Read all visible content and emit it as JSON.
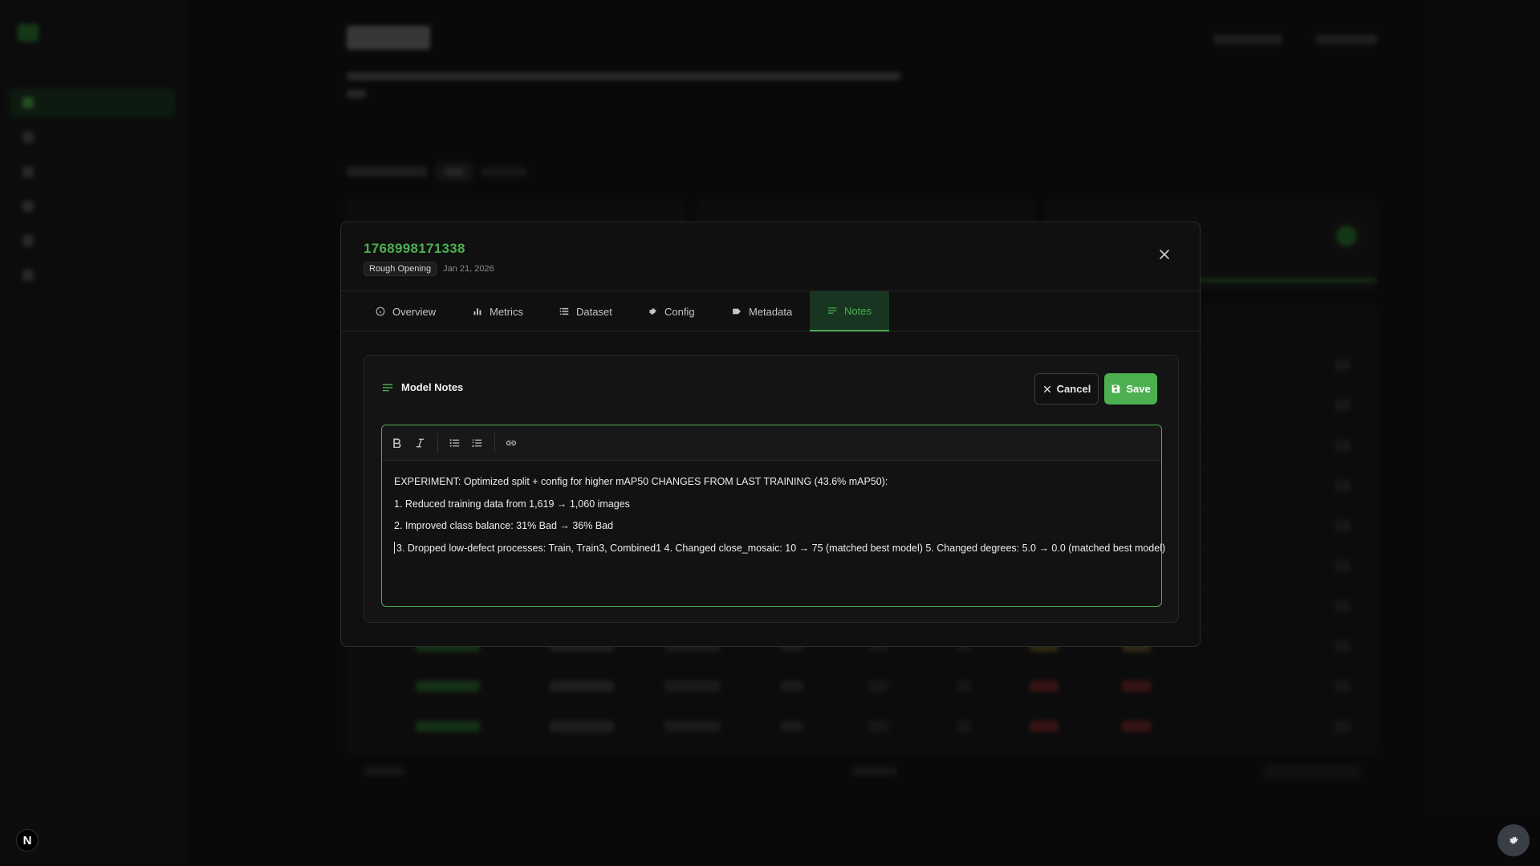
{
  "background": {
    "nav_item_count": 6,
    "row_count": 10
  },
  "modal": {
    "model_id": "1768998171338",
    "category": "Rough Opening",
    "date": "Jan 21, 2026",
    "tabs": [
      {
        "label": "Overview",
        "icon": "info-icon"
      },
      {
        "label": "Metrics",
        "icon": "bar-chart-icon"
      },
      {
        "label": "Dataset",
        "icon": "list-icon"
      },
      {
        "label": "Config",
        "icon": "gear-icon"
      },
      {
        "label": "Metadata",
        "icon": "tag-icon"
      },
      {
        "label": "Notes",
        "icon": "notes-icon",
        "active": true
      }
    ],
    "notes": {
      "title": "Model Notes",
      "cancel_label": "Cancel",
      "save_label": "Save",
      "lines": [
        "EXPERIMENT: Optimized split + config for higher mAP50 CHANGES FROM LAST TRAINING (43.6% mAP50):",
        "1. Reduced training data from 1,619 → 1,060 images",
        "2. Improved class balance: 31% Bad → 36% Bad",
        "3. Dropped low-defect processes: Train, Train3, Combined1 4. Changed close_mosaic: 10 → 75 (matched best model) 5. Changed degrees: 5.0 → 0.0 (matched best model)"
      ]
    }
  },
  "colors": {
    "accent": "#4caf50",
    "modal_bg": "#101010",
    "active_tab_bg": "#173520"
  }
}
